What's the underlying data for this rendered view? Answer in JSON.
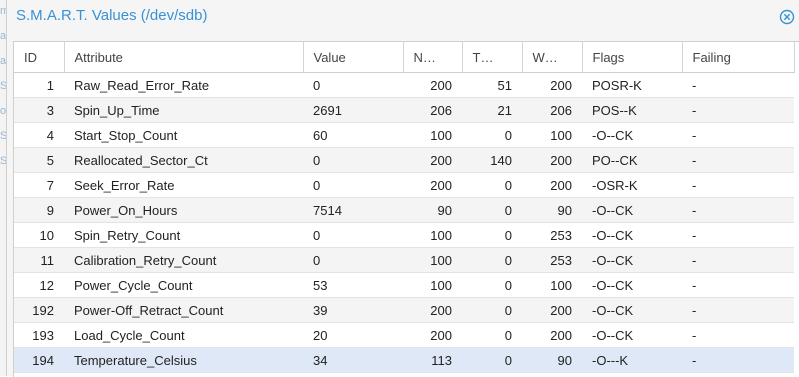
{
  "window": {
    "title": "S.M.A.R.T. Values (/dev/sdb)",
    "close_icon": "close-circle-icon"
  },
  "columns": [
    "ID",
    "Attribute",
    "Value",
    "N…",
    "T…",
    "W…",
    "Flags",
    "Failing"
  ],
  "rows": [
    {
      "id": "1",
      "attribute": "Raw_Read_Error_Rate",
      "value": "0",
      "normalized": "200",
      "threshold": "51",
      "worst": "200",
      "flags": "POSR-K",
      "failing": "-"
    },
    {
      "id": "3",
      "attribute": "Spin_Up_Time",
      "value": "2691",
      "normalized": "206",
      "threshold": "21",
      "worst": "206",
      "flags": "POS--K",
      "failing": "-"
    },
    {
      "id": "4",
      "attribute": "Start_Stop_Count",
      "value": "60",
      "normalized": "100",
      "threshold": "0",
      "worst": "100",
      "flags": "-O--CK",
      "failing": "-"
    },
    {
      "id": "5",
      "attribute": "Reallocated_Sector_Ct",
      "value": "0",
      "normalized": "200",
      "threshold": "140",
      "worst": "200",
      "flags": "PO--CK",
      "failing": "-"
    },
    {
      "id": "7",
      "attribute": "Seek_Error_Rate",
      "value": "0",
      "normalized": "200",
      "threshold": "0",
      "worst": "200",
      "flags": "-OSR-K",
      "failing": "-"
    },
    {
      "id": "9",
      "attribute": "Power_On_Hours",
      "value": "7514",
      "normalized": "90",
      "threshold": "0",
      "worst": "90",
      "flags": "-O--CK",
      "failing": "-"
    },
    {
      "id": "10",
      "attribute": "Spin_Retry_Count",
      "value": "0",
      "normalized": "100",
      "threshold": "0",
      "worst": "253",
      "flags": "-O--CK",
      "failing": "-"
    },
    {
      "id": "11",
      "attribute": "Calibration_Retry_Count",
      "value": "0",
      "normalized": "100",
      "threshold": "0",
      "worst": "253",
      "flags": "-O--CK",
      "failing": "-"
    },
    {
      "id": "12",
      "attribute": "Power_Cycle_Count",
      "value": "53",
      "normalized": "100",
      "threshold": "0",
      "worst": "100",
      "flags": "-O--CK",
      "failing": "-"
    },
    {
      "id": "192",
      "attribute": "Power-Off_Retract_Count",
      "value": "39",
      "normalized": "200",
      "threshold": "0",
      "worst": "200",
      "flags": "-O--CK",
      "failing": "-"
    },
    {
      "id": "193",
      "attribute": "Load_Cycle_Count",
      "value": "20",
      "normalized": "200",
      "threshold": "0",
      "worst": "200",
      "flags": "-O--CK",
      "failing": "-"
    },
    {
      "id": "194",
      "attribute": "Temperature_Celsius",
      "value": "34",
      "normalized": "113",
      "threshold": "0",
      "worst": "90",
      "flags": "-O---K",
      "failing": "-"
    }
  ],
  "selected_row": 11,
  "colors": {
    "title": "#3892d4",
    "selected_row": "#dfe8f6",
    "alt_row": "#f4f4f4"
  }
}
